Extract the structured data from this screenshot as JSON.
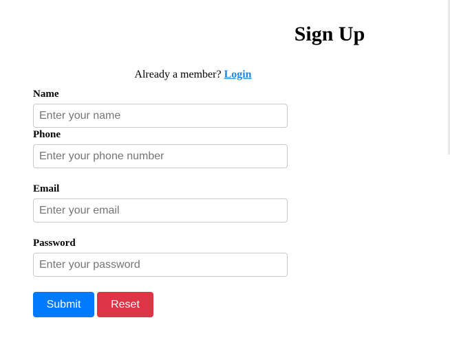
{
  "page": {
    "title": "Sign Up",
    "login_prompt": "Already a member?",
    "login_link": "Login"
  },
  "form": {
    "fields": [
      {
        "label": "Name",
        "placeholder": "Enter your name",
        "value": ""
      },
      {
        "label": "Phone",
        "placeholder": "Enter your phone number",
        "value": ""
      },
      {
        "label": "Email",
        "placeholder": "Enter your email",
        "value": ""
      },
      {
        "label": "Password",
        "placeholder": "Enter your password",
        "value": ""
      }
    ],
    "submit_label": "Submit",
    "reset_label": "Reset"
  },
  "colors": {
    "link": "#1e88e5",
    "submit": "#007bff",
    "reset": "#dc3545"
  }
}
